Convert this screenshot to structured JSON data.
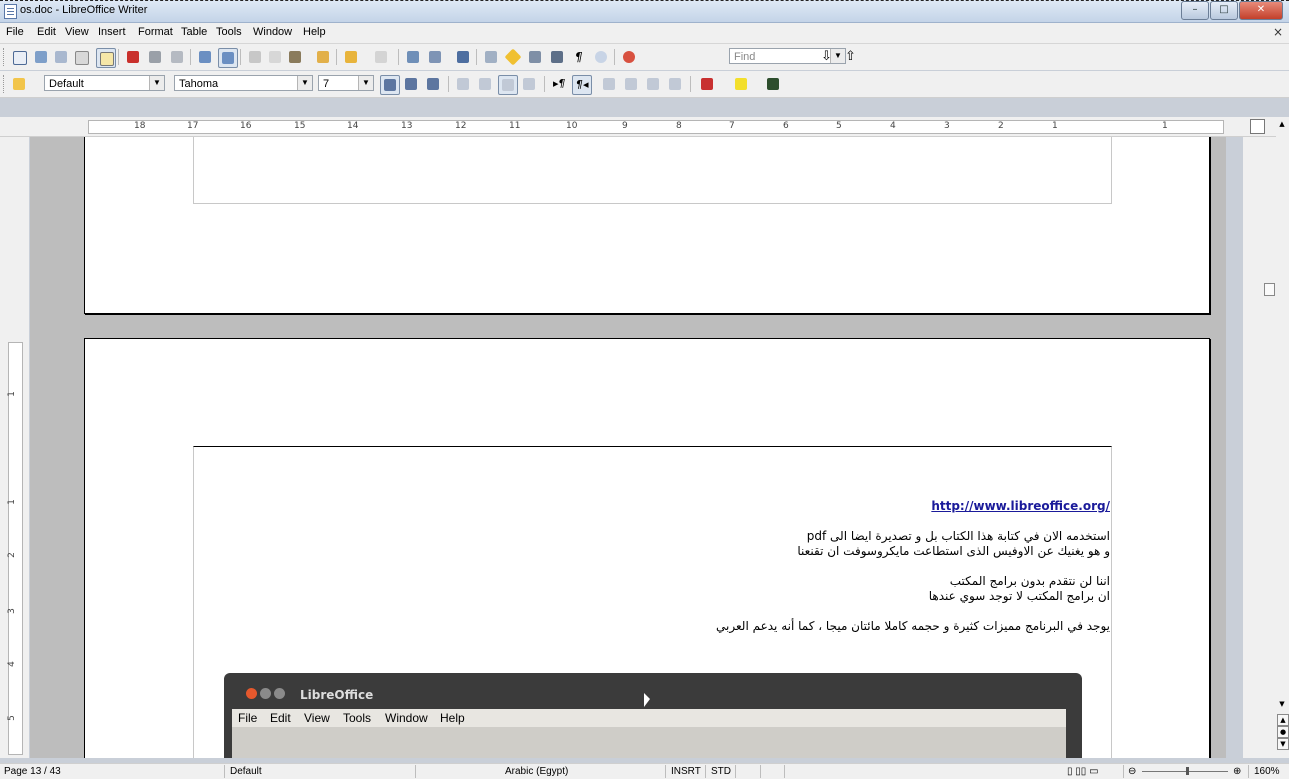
{
  "window": {
    "title": "os.doc - LibreOffice Writer",
    "minimize": "–",
    "maximize": "□",
    "close": "✕"
  },
  "menubar": {
    "items": [
      "File",
      "Edit",
      "View",
      "Insert",
      "Format",
      "Table",
      "Tools",
      "Window",
      "Help"
    ],
    "close_doc": "×"
  },
  "toolbar": {
    "find_placeholder": "Find",
    "style_value": "Default",
    "font_value": "Tahoma",
    "size_value": "7"
  },
  "ruler": {
    "labels": [
      "18",
      "17",
      "16",
      "15",
      "14",
      "13",
      "12",
      "11",
      "10",
      "9",
      "8",
      "7",
      "6",
      "5",
      "4",
      "3",
      "2",
      "1",
      "1"
    ]
  },
  "vruler": {
    "labels": [
      "1",
      "1",
      "2",
      "3",
      "4",
      "5"
    ]
  },
  "document": {
    "link": "/http://www.libreoffice.org",
    "lines": [
      "استخدمه الان في كتابة هذا الكتاب بل و تصديرة ايضا الى pdf",
      "و هو يغنيك عن الاوفيس الذى استطاعت مايكروسوفت ان تقنعنا",
      "اننا لن نتقدم بدون برامج المكتب",
      "ان برامج المكتب لا توجد سوي عندها",
      "يوجد في البرنامج مميزات كثيرة و حجمه كاملا مائتان ميجا ، كما أنه يدعم العربي"
    ],
    "screenshot": {
      "title": "LibreOffice",
      "menu": [
        "File",
        "Edit",
        "View",
        "Tools",
        "Window",
        "Help"
      ]
    }
  },
  "statusbar": {
    "page": "Page 13 / 43",
    "style": "Default",
    "language": "Arabic (Egypt)",
    "insert_mode": "INSRT",
    "selection_mode": "STD",
    "zoom": "160%"
  },
  "colors": {
    "link": "#1a1a9a",
    "close_button": "#c3402b"
  }
}
